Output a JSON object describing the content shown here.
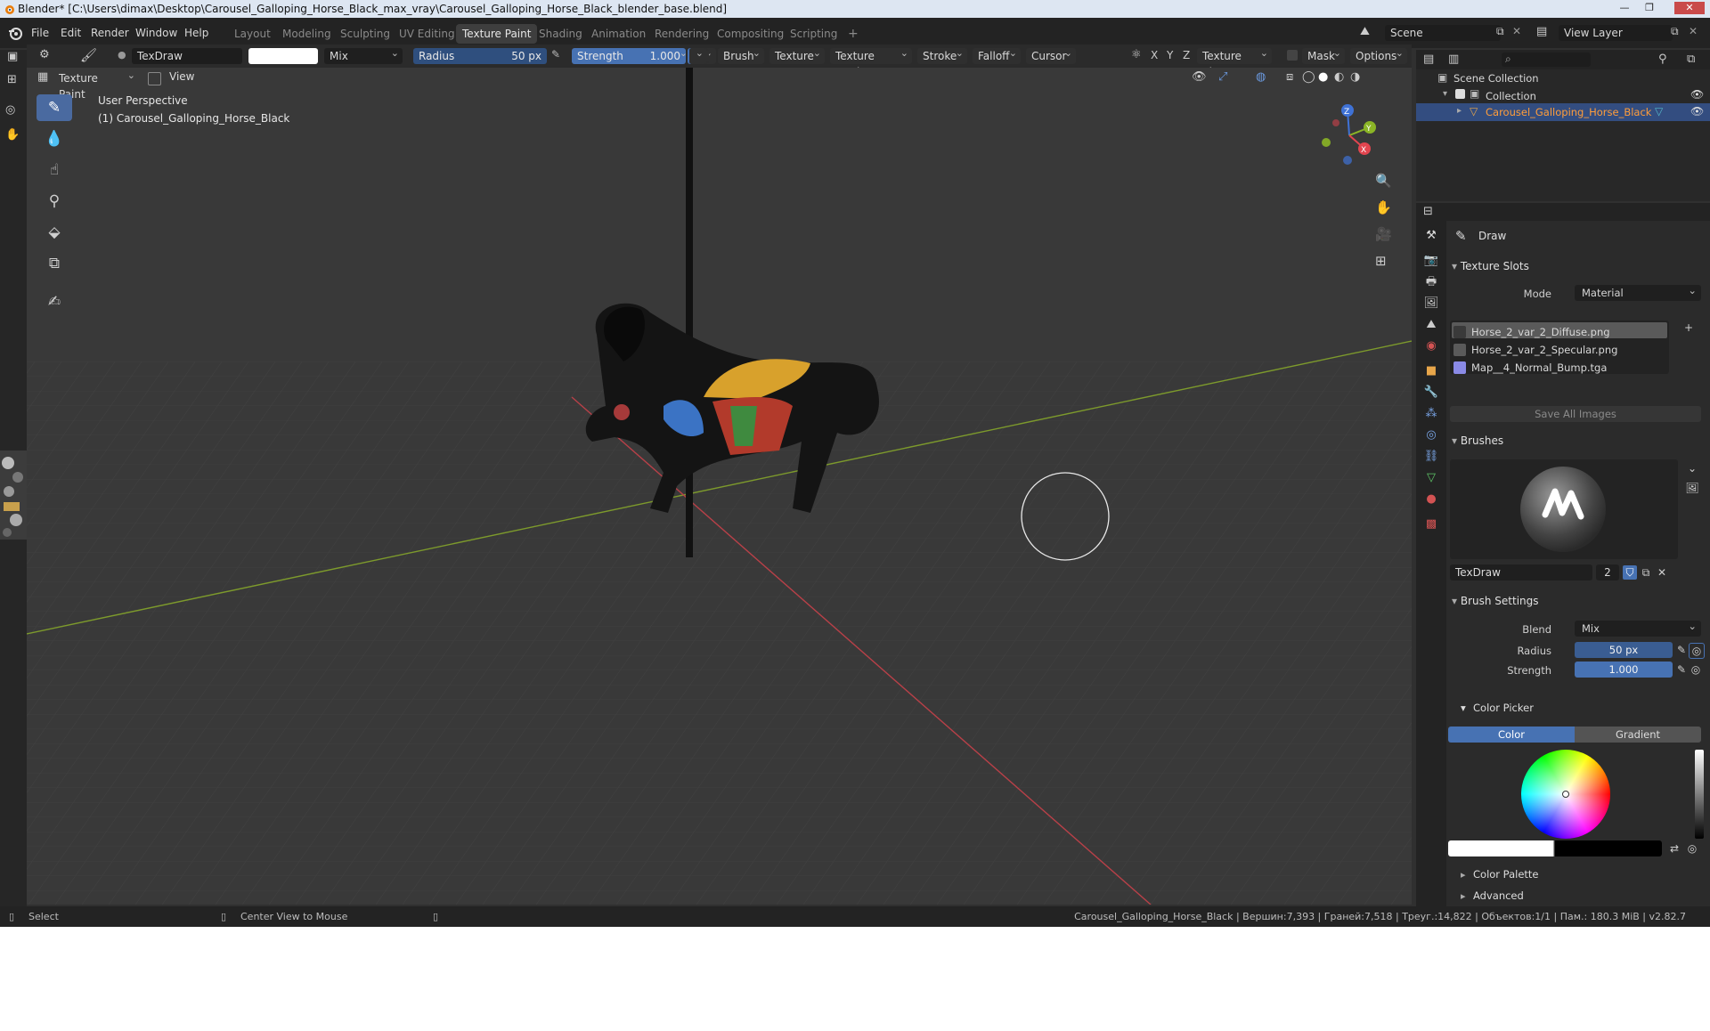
{
  "window": {
    "title": "Blender* [C:\\Users\\dimax\\Desktop\\Carousel_Galloping_Horse_Black_max_vray\\Carousel_Galloping_Horse_Black_blender_base.blend]",
    "minimize": "—",
    "maximize": "❐",
    "close": "✕"
  },
  "menu": [
    "File",
    "Edit",
    "Render",
    "Window",
    "Help"
  ],
  "workspaces": [
    "Layout",
    "Modeling",
    "Sculpting",
    "UV Editing",
    "Texture Paint",
    "Shading",
    "Animation",
    "Rendering",
    "Compositing",
    "Scripting",
    "+"
  ],
  "active_workspace": "Texture Paint",
  "scene": {
    "label": "Scene",
    "view_layer": "View Layer"
  },
  "tool_header": {
    "brush_name": "TexDraw",
    "blend": "Mix",
    "radius_label": "Radius",
    "radius_value": "50 px",
    "strength_label": "Strength",
    "strength_value": "1.000",
    "menus": [
      "Brush",
      "Texture",
      "Texture Mask",
      "Stroke",
      "Falloff",
      "Cursor"
    ],
    "axes": [
      "X",
      "Y",
      "Z"
    ],
    "texture_slots": "Texture Slots",
    "mask": "Mask",
    "options": "Options"
  },
  "viewport_header": {
    "mode": "Texture Paint",
    "view": "View"
  },
  "viewport": {
    "perspective": "User Perspective",
    "object_label": "(1) Carousel_Galloping_Horse_Black",
    "gizmo_axes": [
      "Z",
      "Y",
      "X"
    ]
  },
  "outliner": {
    "scene_collection": "Scene Collection",
    "collection": "Collection",
    "object": "Carousel_Galloping_Horse_Black"
  },
  "properties": {
    "active_tool": "Draw",
    "texture_slots_title": "Texture Slots",
    "mode_label": "Mode",
    "mode_value": "Material",
    "slots": [
      {
        "name": "Horse_2_var_2_Diffuse.png",
        "color": "#3a3a3a"
      },
      {
        "name": "Horse_2_var_2_Specular.png",
        "color": "#5a5a5a"
      },
      {
        "name": "Map__4_Normal_Bump.tga",
        "color": "#8a8ae6"
      }
    ],
    "save_all": "Save All Images",
    "brushes_title": "Brushes",
    "brush_name": "TexDraw",
    "brush_users": "2",
    "brush_settings_title": "Brush Settings",
    "blend_label": "Blend",
    "blend_value": "Mix",
    "radius_label": "Radius",
    "radius_value": "50 px",
    "strength_label": "Strength",
    "strength_value": "1.000",
    "color_picker_title": "Color Picker",
    "color_tab": "Color",
    "gradient_tab": "Gradient",
    "color_palette": "Color Palette",
    "advanced": "Advanced"
  },
  "status": {
    "select": "Select",
    "center_view": "Center View to Mouse",
    "info": "Carousel_Galloping_Horse_Black | Вершин:7,393 | Граней:7,518 | Треуг.:14,822 | Объектов:1/1 | Пам.: 180.3 MiB | v2.82.7"
  },
  "colors": {
    "accent": "#4772b3",
    "axis_x": "#e2454f",
    "axis_y": "#8bb526",
    "axis_z": "#3f72d6"
  }
}
